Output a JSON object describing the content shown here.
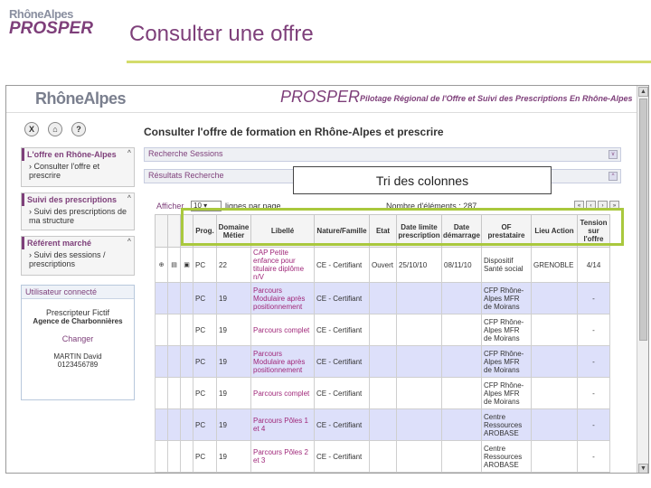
{
  "slide": {
    "logo_region": "RhôneAlpes",
    "logo_app": "PROSPER",
    "title": "Consulter une offre"
  },
  "app": {
    "header_region": "RhôneAlpes",
    "header_app": "PROSPER",
    "header_subtitle": "Pilotage Régional de l'Offre et Suivi des Prescriptions En Rhône-Alpes"
  },
  "toolbar": {
    "close": "X",
    "home": "⌂",
    "help": "?"
  },
  "sidebar": {
    "groups": [
      {
        "title": "L'offre en Rhône-Alpes",
        "items": [
          "Consulter l'offre et prescrire"
        ]
      },
      {
        "title": "Suivi des prescriptions",
        "items": [
          "Suivi des prescriptions de ma structure"
        ]
      },
      {
        "title": "Référent marché",
        "items": [
          "Suivi des sessions / prescriptions"
        ]
      }
    ],
    "user": {
      "heading": "Utilisateur connecté",
      "role": "Prescripteur Fictif",
      "agency": "Agence de Charbonnières",
      "change": "Changer",
      "name": "MARTIN David",
      "phone": "0123456789"
    }
  },
  "main": {
    "title": "Consulter l'offre de formation en Rhône-Alpes et prescrire",
    "search_sessions": "Recherche Sessions",
    "search_results": "Résultats Recherche",
    "show_label": "Afficher",
    "page_size": "10",
    "per_page_label": "lignes par page.",
    "count_label": "Nombre d'éléments : 287",
    "columns": [
      "Prog.",
      "Domaine Métier",
      "Libellé",
      "Nature/Famille",
      "Etat",
      "Date limite prescription",
      "Date démarrage",
      "OF prestataire",
      "Lieu Action",
      "Tension sur l'offre"
    ],
    "rows": [
      {
        "prog": "PC",
        "dom": "22",
        "lib": "CAP Petite enfance pour titulaire diplôme n/V",
        "nat": "CE - Certifiant",
        "etat": "Ouvert",
        "dlp": "25/10/10",
        "dd": "08/11/10",
        "of": "Dispositif Santé social",
        "lieu": "GRENOBLE",
        "tension": "4/14"
      },
      {
        "prog": "PC",
        "dom": "19",
        "lib": "Parcours Modulaire après positionnement",
        "nat": "CE - Certifiant",
        "etat": "",
        "dlp": "",
        "dd": "",
        "of": "CFP Rhône-Alpes MFR de Moirans",
        "lieu": "",
        "tension": "-"
      },
      {
        "prog": "PC",
        "dom": "19",
        "lib": "Parcours complet",
        "nat": "CE - Certifiant",
        "etat": "",
        "dlp": "",
        "dd": "",
        "of": "CFP Rhône-Alpes MFR de Moirans",
        "lieu": "",
        "tension": "-"
      },
      {
        "prog": "PC",
        "dom": "19",
        "lib": "Parcours Modulaire après positionnement",
        "nat": "CE - Certifiant",
        "etat": "",
        "dlp": "",
        "dd": "",
        "of": "CFP Rhône-Alpes MFR de Moirans",
        "lieu": "",
        "tension": "-"
      },
      {
        "prog": "PC",
        "dom": "19",
        "lib": "Parcours complet",
        "nat": "CE - Certifiant",
        "etat": "",
        "dlp": "",
        "dd": "",
        "of": "CFP Rhône-Alpes MFR de Moirans",
        "lieu": "",
        "tension": "-"
      },
      {
        "prog": "PC",
        "dom": "19",
        "lib": "Parcours Pôles 1 et 4",
        "nat": "CE - Certifiant",
        "etat": "",
        "dlp": "",
        "dd": "",
        "of": "Centre Ressources AROBASE",
        "lieu": "",
        "tension": "-"
      },
      {
        "prog": "PC",
        "dom": "19",
        "lib": "Parcours Pôles 2 et 3",
        "nat": "CE - Certifiant",
        "etat": "",
        "dlp": "",
        "dd": "",
        "of": "Centre Ressources AROBASE",
        "lieu": "",
        "tension": "-"
      }
    ]
  },
  "callout": "Tri des colonnes",
  "colors": {
    "brand": "#7e3f7a",
    "highlight": "#a9c83d",
    "row_highlight": "#dde0fa"
  }
}
